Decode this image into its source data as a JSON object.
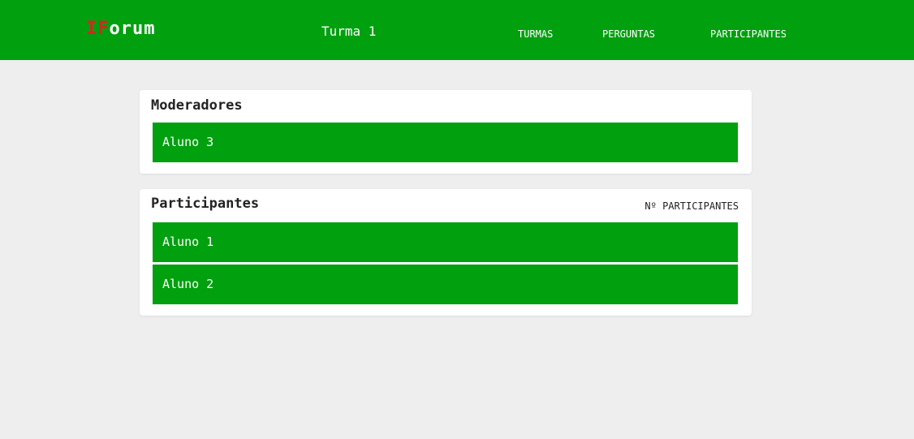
{
  "header": {
    "logo_prefix": "IF",
    "logo_suffix": "orum",
    "class_title": "Turma 1",
    "nav": {
      "turmas": "TURMAS",
      "perguntas": "PERGUNTAS",
      "participantes": "PARTICIPANTES"
    }
  },
  "moderators": {
    "title": "Moderadores",
    "items": [
      "Aluno 3"
    ]
  },
  "participants": {
    "title": "Participantes",
    "count_label": "Nº PARTICIPANTES",
    "items": [
      "Aluno 1",
      "Aluno 2"
    ]
  },
  "colors": {
    "brand_green": "#01a00f",
    "logo_accent": "#d7261e",
    "page_background": "#eeeeee"
  }
}
